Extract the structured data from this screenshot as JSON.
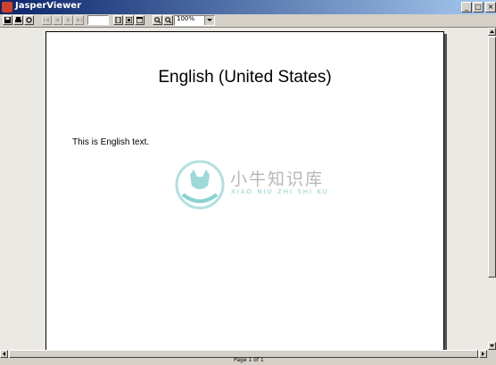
{
  "window": {
    "title": "JasperViewer",
    "min_symbol": "_",
    "max_symbol": "□",
    "close_symbol": "×"
  },
  "toolbar": {
    "zoom_value": "100%",
    "page_number": ""
  },
  "report": {
    "title": "English (United States)",
    "body_text": "This is English text."
  },
  "watermark": {
    "chinese": "小牛知识库",
    "pinyin": "XIAO NIU ZHI SHI KU"
  },
  "status": {
    "page_info": "Page 1 of 1"
  },
  "colors": {
    "title_bar": "#0a246a",
    "watermark_teal": "#5fbfbf"
  }
}
